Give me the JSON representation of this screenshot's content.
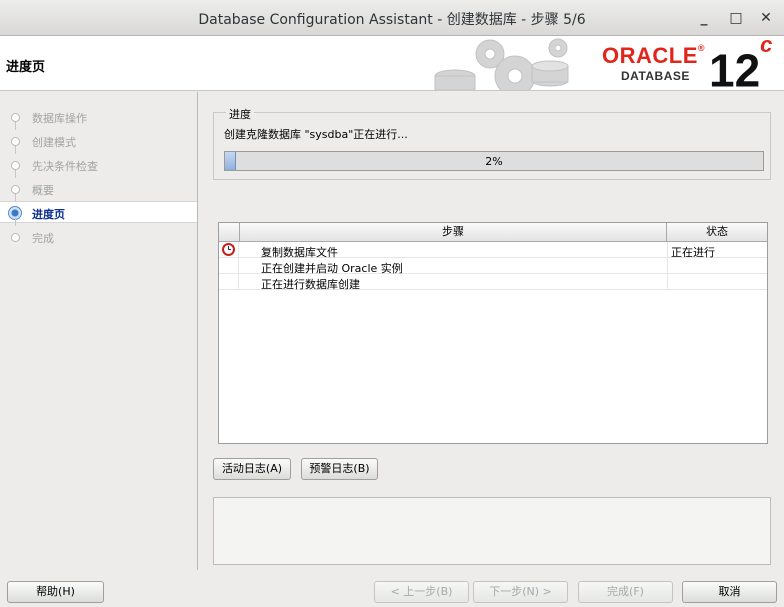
{
  "window": {
    "title": "Database Configuration Assistant - 创建数据库 - 步骤 5/6",
    "minimize_glyph": "_",
    "maximize_glyph": "□",
    "close_glyph": "✕"
  },
  "header": {
    "page_title": "进度页",
    "logo_oracle": "ORACLE",
    "logo_registered": "®",
    "logo_database": "DATABASE",
    "logo_version": "12",
    "logo_version_suffix": "c"
  },
  "sidebar": {
    "steps": [
      {
        "label": "数据库操作"
      },
      {
        "label": "创建模式"
      },
      {
        "label": "先决条件检查"
      },
      {
        "label": "概要"
      },
      {
        "label": "进度页"
      },
      {
        "label": "完成"
      }
    ],
    "active_index": 4
  },
  "progress": {
    "legend": "进度",
    "message": "创建克隆数据库 \"sysdba\"正在进行...",
    "percent_text": "2%",
    "percent_value": 0.02
  },
  "steps_table": {
    "columns": [
      "步骤",
      "状态"
    ],
    "rows": [
      {
        "icon": "clock-icon",
        "step": "复制数据库文件",
        "status": "正在进行"
      },
      {
        "icon": "",
        "step": "正在创建并启动 Oracle 实例",
        "status": ""
      },
      {
        "icon": "",
        "step": "正在进行数据库创建",
        "status": ""
      }
    ]
  },
  "log_buttons": {
    "activity_log": "活动日志(A)",
    "alert_log": "预警日志(B)"
  },
  "footer": {
    "help": "帮助(H)",
    "back": "< 上一步(B)",
    "next": "下一步(N) >",
    "finish": "完成(F)",
    "cancel": "取消"
  },
  "colors": {
    "oracle_red": "#e0261b",
    "active_step_text": "#0b2e8c",
    "progress_fill": "#8fb1dd"
  }
}
